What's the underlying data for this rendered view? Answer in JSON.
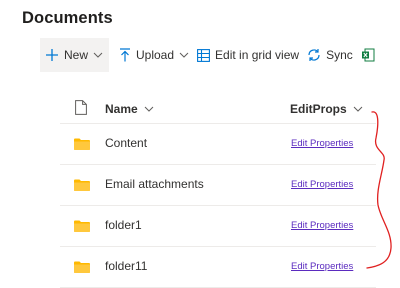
{
  "page": {
    "title": "Documents"
  },
  "toolbar": {
    "new_label": "New",
    "upload_label": "Upload",
    "grid_label": "Edit in grid view",
    "sync_label": "Sync"
  },
  "columns": {
    "name": "Name",
    "editprops": "EditProps"
  },
  "rows": [
    {
      "name": "Content",
      "link": "Edit Properties"
    },
    {
      "name": "Email attachments",
      "link": "Edit Properties"
    },
    {
      "name": "folder1",
      "link": "Edit Properties"
    },
    {
      "name": "folder11",
      "link": "Edit Properties"
    }
  ],
  "colors": {
    "accent": "#0078d4",
    "folder": "#ffb900",
    "link": "#5b2bbf",
    "annotation": "#e02020",
    "excel": "#107c41"
  },
  "icons": [
    "plus-icon",
    "chevron-down-icon",
    "upload-icon",
    "grid-icon",
    "sync-icon",
    "excel-icon",
    "file-icon",
    "folder-icon"
  ]
}
